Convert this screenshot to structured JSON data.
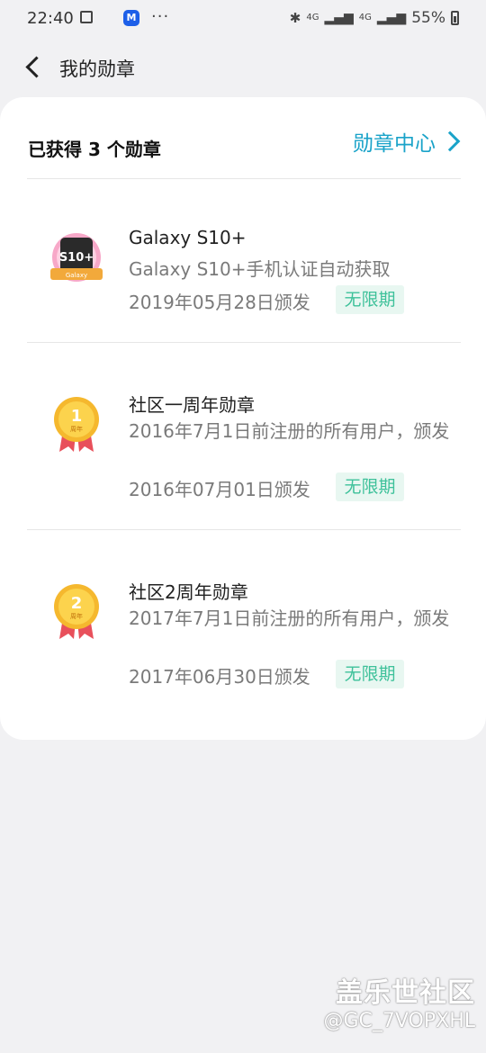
{
  "status_bar": {
    "time": "22:40",
    "more": "···",
    "network1": "4G",
    "network2": "4G",
    "battery": "55%"
  },
  "header": {
    "back_icon": "chevron-left-icon",
    "title": "我的勋章"
  },
  "summary": {
    "count_text": "已获得 3 个勋章",
    "center_link": "勋章中心"
  },
  "badges": [
    {
      "name": "Galaxy S10+",
      "description": "Galaxy S10+手机认证自动获取",
      "issued": "2019年05月28日颁发",
      "validity": "无限期",
      "icon_text": "S10+",
      "icon_sub": "Galaxy"
    },
    {
      "name": "社区一周年勋章",
      "description": "2016年7月1日前注册的所有用户，颁发",
      "issued": "2016年07月01日颁发",
      "validity": "无限期",
      "icon_num": "1",
      "icon_sub": "周年"
    },
    {
      "name": "社区2周年勋章",
      "description": "2017年7月1日前注册的所有用户，颁发",
      "issued": "2017年06月30日颁发",
      "validity": "无限期",
      "icon_num": "2",
      "icon_sub": "周年"
    }
  ],
  "watermark": {
    "line1": "盖乐世社区",
    "line2": "@GC_7VOPXHL"
  },
  "colors": {
    "accent": "#1aa3c9",
    "tag_text": "#3ec19a",
    "tag_bg": "#e8f7f1",
    "background": "#f1f1f3"
  }
}
